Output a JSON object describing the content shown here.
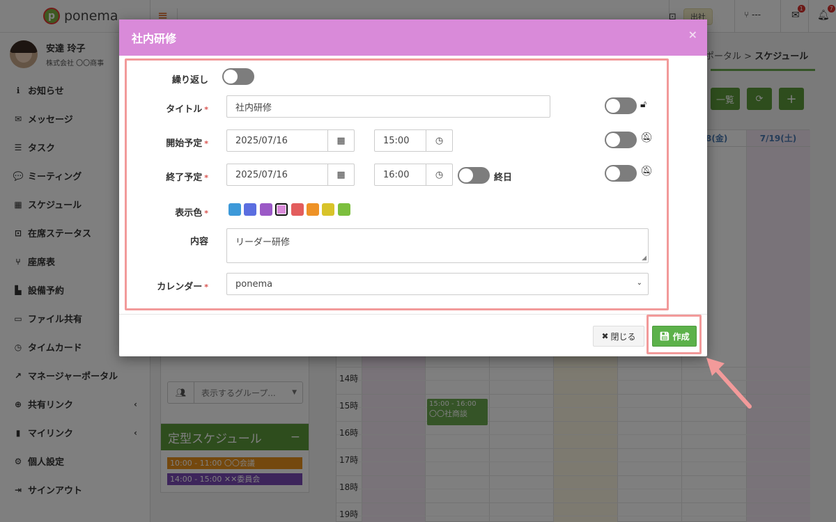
{
  "app": {
    "brand": "ponema",
    "user": {
      "name": "安達 玲子",
      "company": "株式会社 〇〇商事"
    },
    "nav": [
      {
        "label": "お知らせ",
        "icon": "info-icon",
        "glyph": "ℹ"
      },
      {
        "label": "メッセージ",
        "icon": "mail-icon",
        "glyph": "✉"
      },
      {
        "label": "タスク",
        "icon": "tasks-icon",
        "glyph": "☰"
      },
      {
        "label": "ミーティング",
        "icon": "chat-icon",
        "glyph": "💬"
      },
      {
        "label": "スケジュール",
        "icon": "calendar-icon",
        "glyph": "▦"
      },
      {
        "label": "在席ステータス",
        "icon": "presence-icon",
        "glyph": "⊡"
      },
      {
        "label": "座席表",
        "icon": "seat-icon",
        "glyph": "⑂"
      },
      {
        "label": "設備予約",
        "icon": "facility-icon",
        "glyph": "▙"
      },
      {
        "label": "ファイル共有",
        "icon": "folder-icon",
        "glyph": "▭"
      },
      {
        "label": "タイムカード",
        "icon": "clock-icon",
        "glyph": "◷"
      },
      {
        "label": "マネージャーポータル",
        "icon": "chart-icon",
        "glyph": "↗"
      },
      {
        "label": "共有リンク",
        "icon": "globe-icon",
        "glyph": "⊕",
        "chevron": "‹"
      },
      {
        "label": "マイリンク",
        "icon": "bookmark-icon",
        "glyph": "▮",
        "chevron": "‹"
      },
      {
        "label": "個人設定",
        "icon": "gear-icon",
        "glyph": "⚙"
      },
      {
        "label": "サインアウト",
        "icon": "signout-icon",
        "glyph": "⇥"
      }
    ],
    "topbar": {
      "attend_label": "出社",
      "seat_label": "---",
      "mail_count": "1",
      "bell_count": "7"
    },
    "breadcrumb": {
      "prefix": "ポータル",
      "separator": ">",
      "current": "スケジュール"
    },
    "list_button": "一覧",
    "group_select_placeholder": "表示するグループ...",
    "fixed_schedule": {
      "title": "定型スケジュール",
      "collapse": "−",
      "items": [
        {
          "text": "10:00 - 11:00 〇〇会議",
          "color": "#e8901c"
        },
        {
          "text": "14:00 - 15:00 ✕✕委員会",
          "color": "#7b4bb7"
        }
      ]
    },
    "calendar": {
      "headers": [
        "18(金)",
        "7/19(土)"
      ],
      "times": [
        "14時",
        "15時",
        "16時",
        "17時",
        "18時",
        "19時"
      ],
      "event": {
        "time": "15:00 - 16:00",
        "title": "〇〇社商談"
      }
    }
  },
  "modal": {
    "title": "社内研修",
    "close": "×",
    "fields": {
      "repeat_label": "繰り返し",
      "title_label": "タイトル",
      "title_value": "社内研修",
      "start_label": "開始予定",
      "start_date": "2025/07/16",
      "start_time": "15:00",
      "end_label": "終了予定",
      "end_date": "2025/07/16",
      "end_time": "16:00",
      "allday_label": "終日",
      "color_label": "表示色",
      "content_label": "内容",
      "content_value": "リーダー研修",
      "calendar_label": "カレンダー",
      "calendar_value": "ponema",
      "required_mark": "*"
    },
    "colors": [
      "#3d99d9",
      "#5b6ee0",
      "#9b59c6",
      "#d98ad9",
      "#e35d5d",
      "#ee9226",
      "#d8c32a",
      "#7cbf3e"
    ],
    "selected_color": "#d98ad9",
    "buttons": {
      "close": "閉じる",
      "create": "作成"
    }
  },
  "colors": {
    "accent_green": "#5cb14a",
    "header_purple": "#d98ad9",
    "highlight": "#f29a9a"
  }
}
